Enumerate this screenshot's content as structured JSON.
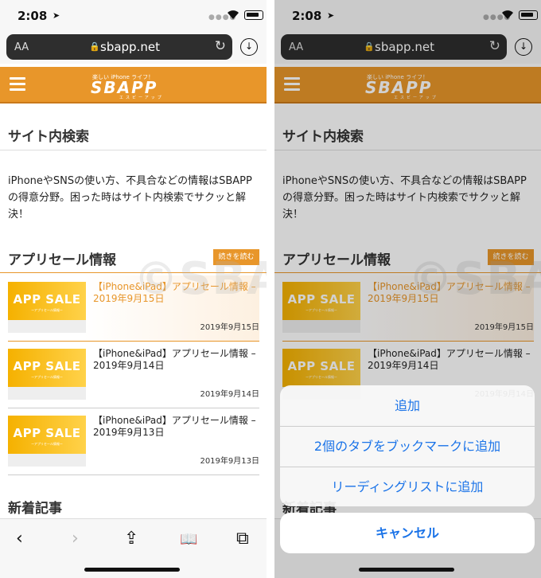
{
  "status": {
    "time": "2:08",
    "location_arrow": "➤"
  },
  "address_bar": {
    "aa": "AA",
    "url": "sbapp.net",
    "lock_icon": "lock-icon",
    "reload_icon": "reload-icon",
    "download_icon": "download-icon"
  },
  "site": {
    "logo_tag": "楽しい iPhone ライフ！",
    "logo": "SBAPP",
    "logo_sub": "エスビーアップ"
  },
  "search_section": {
    "title": "サイト内検索",
    "intro": "iPhoneやSNSの使い方、不具合などの情報はSBAPPの得意分野。困った時はサイト内検索でサクッと解決！"
  },
  "sale_section": {
    "title": "アプリセール情報",
    "read_more": "続きを読む",
    "items": [
      {
        "thumb_text": "APP SALE",
        "thumb_sub": "ーアプリセール情報ー",
        "title": "【iPhone&iPad】アプリセール情報 – 2019年9月15日",
        "date": "2019年9月15日"
      },
      {
        "thumb_text": "APP SALE",
        "thumb_sub": "ーアプリセール情報ー",
        "title": "【iPhone&iPad】アプリセール情報 – 2019年9月14日",
        "date": "2019年9月14日"
      },
      {
        "thumb_text": "APP SALE",
        "thumb_sub": "ーアプリセール情報ー",
        "title": "【iPhone&iPad】アプリセール情報 – 2019年9月13日",
        "date": "2019年9月13日"
      }
    ]
  },
  "new_section": {
    "title": "新着記事"
  },
  "watermark": "©SBAPP",
  "toolbar": {
    "back": "‹",
    "forward": "›",
    "share": "⇪",
    "bookmarks": "📖",
    "tabs": "⧉"
  },
  "action_sheet": {
    "items": [
      "追加",
      "2個のタブをブックマークに追加",
      "リーディングリストに追加"
    ],
    "cancel": "キャンセル"
  }
}
